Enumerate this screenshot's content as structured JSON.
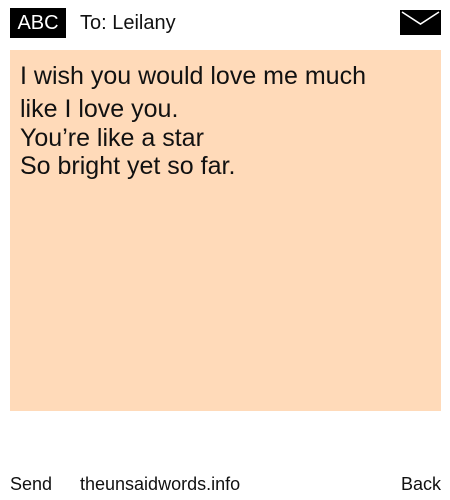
{
  "header": {
    "keyboard_mode": "ABC",
    "recipient": "To: Leilany",
    "mail_icon": "envelope-icon"
  },
  "message": {
    "lines": [
      "I wish you would love me much",
      "like I love you.",
      "You’re like a star",
      "So bright yet so far."
    ],
    "background_color": "#ffdab9"
  },
  "footer": {
    "send_label": "Send",
    "site_link": "theunsaidwords.info",
    "back_label": "Back"
  }
}
